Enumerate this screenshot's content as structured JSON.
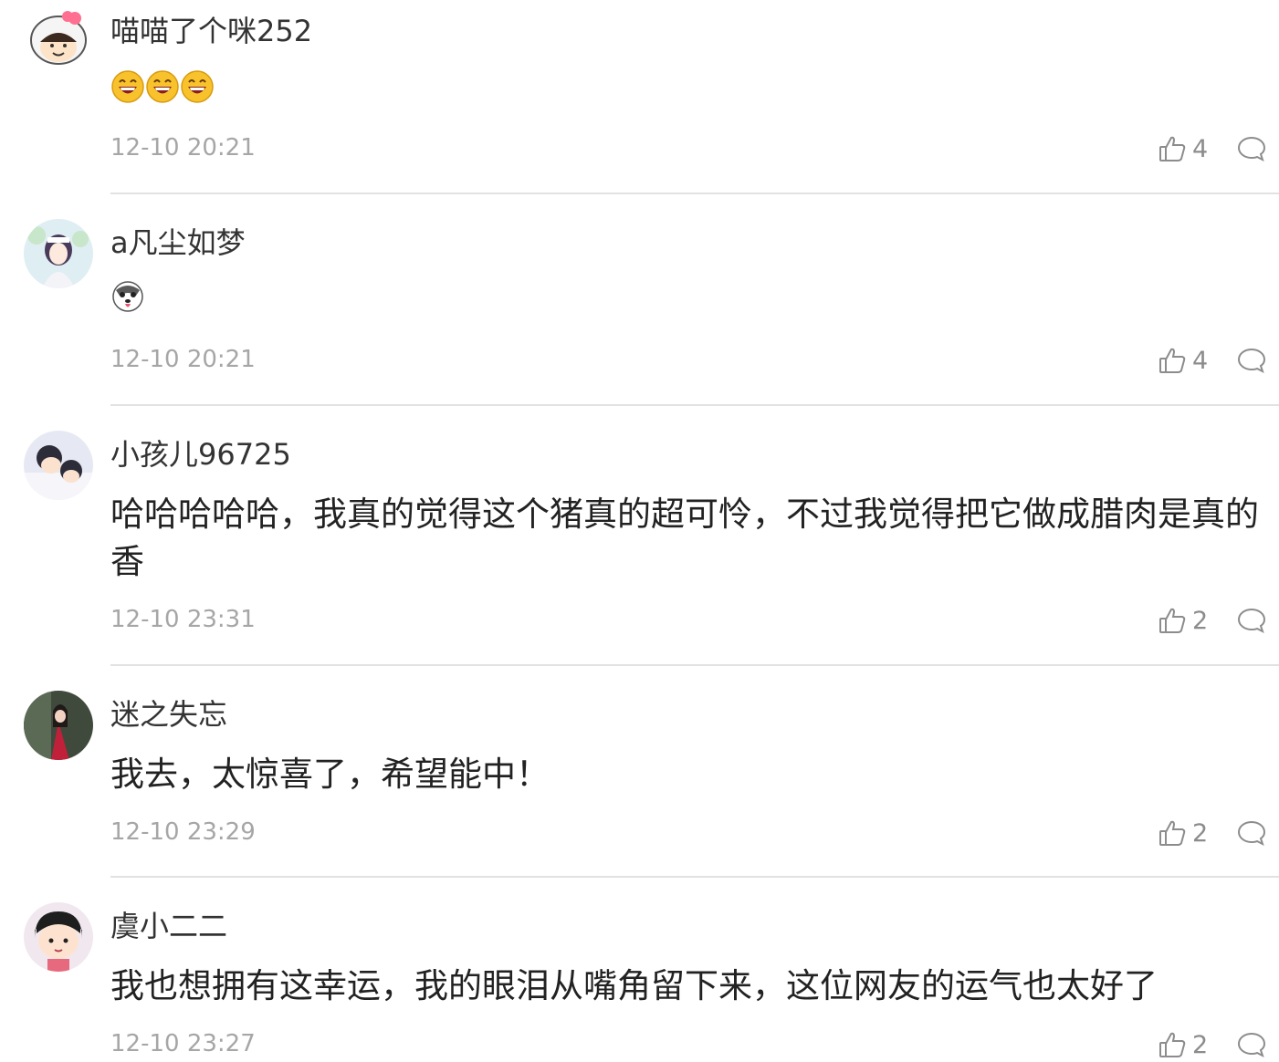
{
  "comments": [
    {
      "username": "喵喵了个咪252",
      "emoji": [
        "laughing-emoji",
        "laughing-emoji",
        "laughing-emoji"
      ],
      "text": "",
      "time": "12-10 20:21",
      "likes": "4"
    },
    {
      "username": "a凡尘如梦",
      "emoji": [
        "husky-emoji"
      ],
      "text": "",
      "time": "12-10 20:21",
      "likes": "4"
    },
    {
      "username": "小孩儿96725",
      "emoji": [],
      "text": "哈哈哈哈哈，我真的觉得这个猪真的超可怜，不过我觉得把它做成腊肉是真的香",
      "time": "12-10 23:31",
      "likes": "2"
    },
    {
      "username": "迷之失忘",
      "emoji": [],
      "text": "我去，太惊喜了，希望能中！",
      "time": "12-10 23:29",
      "likes": "2"
    },
    {
      "username": "虞小二二",
      "emoji": [],
      "text": "我也想拥有这幸运，我的眼泪从嘴角留下来，这位网友的运气也太好了",
      "time": "12-10 23:27",
      "likes": "2"
    }
  ],
  "icons": {
    "like": "thumbs-up-icon",
    "reply": "comment-bubble-icon"
  },
  "colors": {
    "username": "#333333",
    "text": "#222222",
    "meta": "#a6a6a6",
    "icon": "#8c8c8c",
    "divider": "#e2e2e2"
  }
}
